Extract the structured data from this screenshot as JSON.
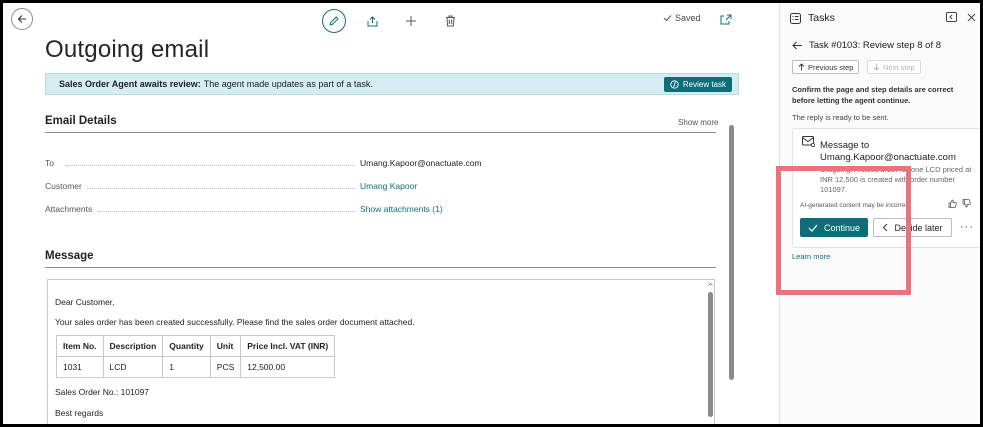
{
  "main": {
    "page_title": "Outgoing email",
    "saved_label": "Saved",
    "banner": {
      "bold_text": "Sales Order Agent awaits review:",
      "text": "The agent made updates as part of a task.",
      "button_label": "Review task"
    },
    "email_details": {
      "heading": "Email Details",
      "show_more": "Show more",
      "fields": [
        {
          "label": "To",
          "value": "Umang.Kapoor@onactuate.com"
        },
        {
          "label": "Customer",
          "value": "Umang Kapoor"
        },
        {
          "label": "Attachments",
          "value": "Show attachments (1)"
        }
      ]
    },
    "message": {
      "heading": "Message",
      "greeting": "Dear Customer,",
      "body": "Your sales order has been created successfully. Please find the sales order document attached.",
      "table": {
        "headers": [
          "Item No.",
          "Description",
          "Quantity",
          "Unit",
          "Price Incl. VAT (INR)"
        ],
        "rows": [
          [
            "1031",
            "LCD",
            "1",
            "PCS",
            "12,500.00"
          ]
        ]
      },
      "order_no": "Sales Order No.: 101097",
      "closing": "Best regards"
    }
  },
  "tasks": {
    "header": "Tasks",
    "task_title": "Task #0103: Review step 8 of 8",
    "prev_step": "Previous step",
    "next_step": "Next step",
    "confirm_text": "Confirm the page and step details are correct before letting the agent continue.",
    "ready_text": "The reply is ready to be sent.",
    "card": {
      "title": "Message to Umang.Kapoor@onactuate.com",
      "description": "Outgoing. A sales order for one LCD priced at INR 12,500 is created with order number 101097.",
      "disclaimer": "AI-generated content may be incorrect",
      "continue_label": "Continue",
      "later_label": "Decide later",
      "more_label": "···"
    },
    "learn_more": "Learn more"
  },
  "colors": {
    "accent": "#0f6d7a",
    "banner_bg": "#d4ecf2",
    "highlight": "#e9737b"
  }
}
